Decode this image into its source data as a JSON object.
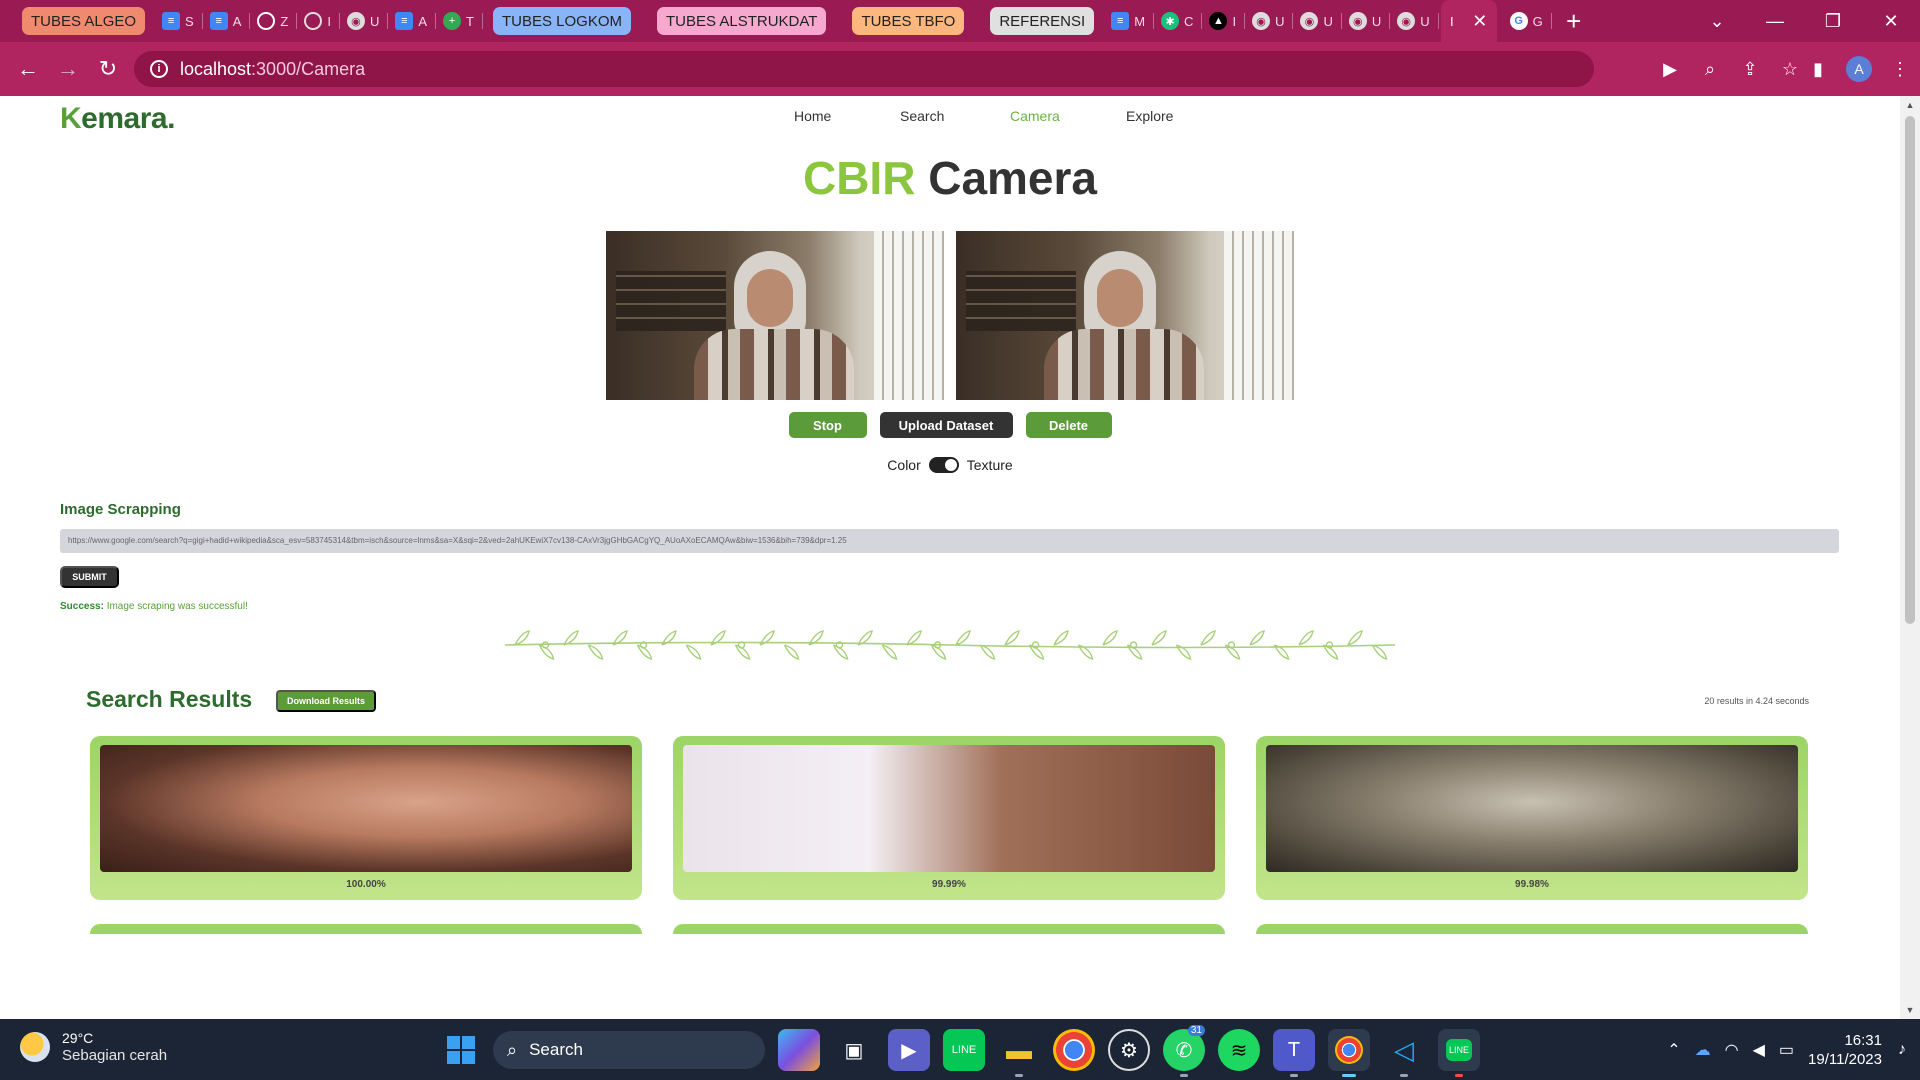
{
  "browser": {
    "tab_groups": [
      {
        "label": "TUBES ALGEO",
        "color": "#f08a6f"
      },
      {
        "label": "TUBES LOGKOM",
        "color": "#8ab4f8"
      },
      {
        "label": "TUBES ALSTRUKDAT",
        "color": "#f7a8cf"
      },
      {
        "label": "TUBES TBFO",
        "color": "#fbb77d"
      },
      {
        "label": "REFERENSI",
        "color": "#e0e0e0"
      }
    ],
    "mini_tabs_a": [
      {
        "icon": "docs-icon",
        "letter": "S"
      },
      {
        "icon": "docs-icon",
        "letter": "A"
      },
      {
        "icon": "github-icon",
        "letter": "Z"
      },
      {
        "icon": "openai-icon",
        "letter": "I"
      },
      {
        "icon": "globe-icon",
        "letter": "U"
      },
      {
        "icon": "docs-icon",
        "letter": "A"
      },
      {
        "icon": "plus-icon",
        "letter": "T"
      }
    ],
    "mini_tabs_b": [
      {
        "icon": "docs-icon",
        "letter": "M"
      },
      {
        "icon": "openai-icon",
        "letter": "C"
      },
      {
        "icon": "vercel-icon",
        "letter": "I"
      },
      {
        "icon": "globe-icon",
        "letter": "U"
      },
      {
        "icon": "globe-icon",
        "letter": "U"
      },
      {
        "icon": "globe-icon",
        "letter": "U"
      },
      {
        "icon": "globe-icon",
        "letter": "U"
      }
    ],
    "active_tab_letter": "I",
    "google_tab_letter": "G",
    "url_host": "localhost",
    "url_path": ":3000/Camera",
    "theme_color": "#b0245f",
    "profile_initial": "A"
  },
  "site": {
    "logo_k": "K",
    "logo_rest": "emara.",
    "nav": [
      {
        "label": "Home",
        "active": false
      },
      {
        "label": "Search",
        "active": false
      },
      {
        "label": "Camera",
        "active": true
      },
      {
        "label": "Explore",
        "active": false
      }
    ],
    "title_accent": "CBIR",
    "title_rest": " Camera",
    "buttons": {
      "stop": "Stop",
      "upload": "Upload Dataset",
      "delete": "Delete"
    },
    "toggle": {
      "left": "Color",
      "right": "Texture",
      "state": "texture"
    },
    "scrapping": {
      "label": "Image Scrapping",
      "url_value": "https://www.google.com/search?q=gigi+hadid+wikipedia&sca_esv=583745314&tbm=isch&source=lnms&sa=X&sqi=2&ved=2ahUKEwiX7cv138-CAxVr3jgGHbGACgYQ_AUoAXoECAMQAw&biw=1536&bih=739&dpr=1.25",
      "submit": "SUBMIT",
      "success_label": "Success:",
      "success_msg": " Image scraping was successful!"
    },
    "results": {
      "title": "Search Results",
      "download": "Download Results",
      "meta": "20 results in 4.24 seconds",
      "cards": [
        {
          "similarity": "100.00%"
        },
        {
          "similarity": "99.99%"
        },
        {
          "similarity": "99.98%"
        }
      ]
    },
    "accent_green": "#8cc63f",
    "dark_green": "#2e6b2e"
  },
  "taskbar": {
    "temp": "29°C",
    "weather": "Sebagian cerah",
    "search": "Search",
    "whatsapp_badge": "31",
    "time": "16:31",
    "date": "19/11/2023"
  }
}
